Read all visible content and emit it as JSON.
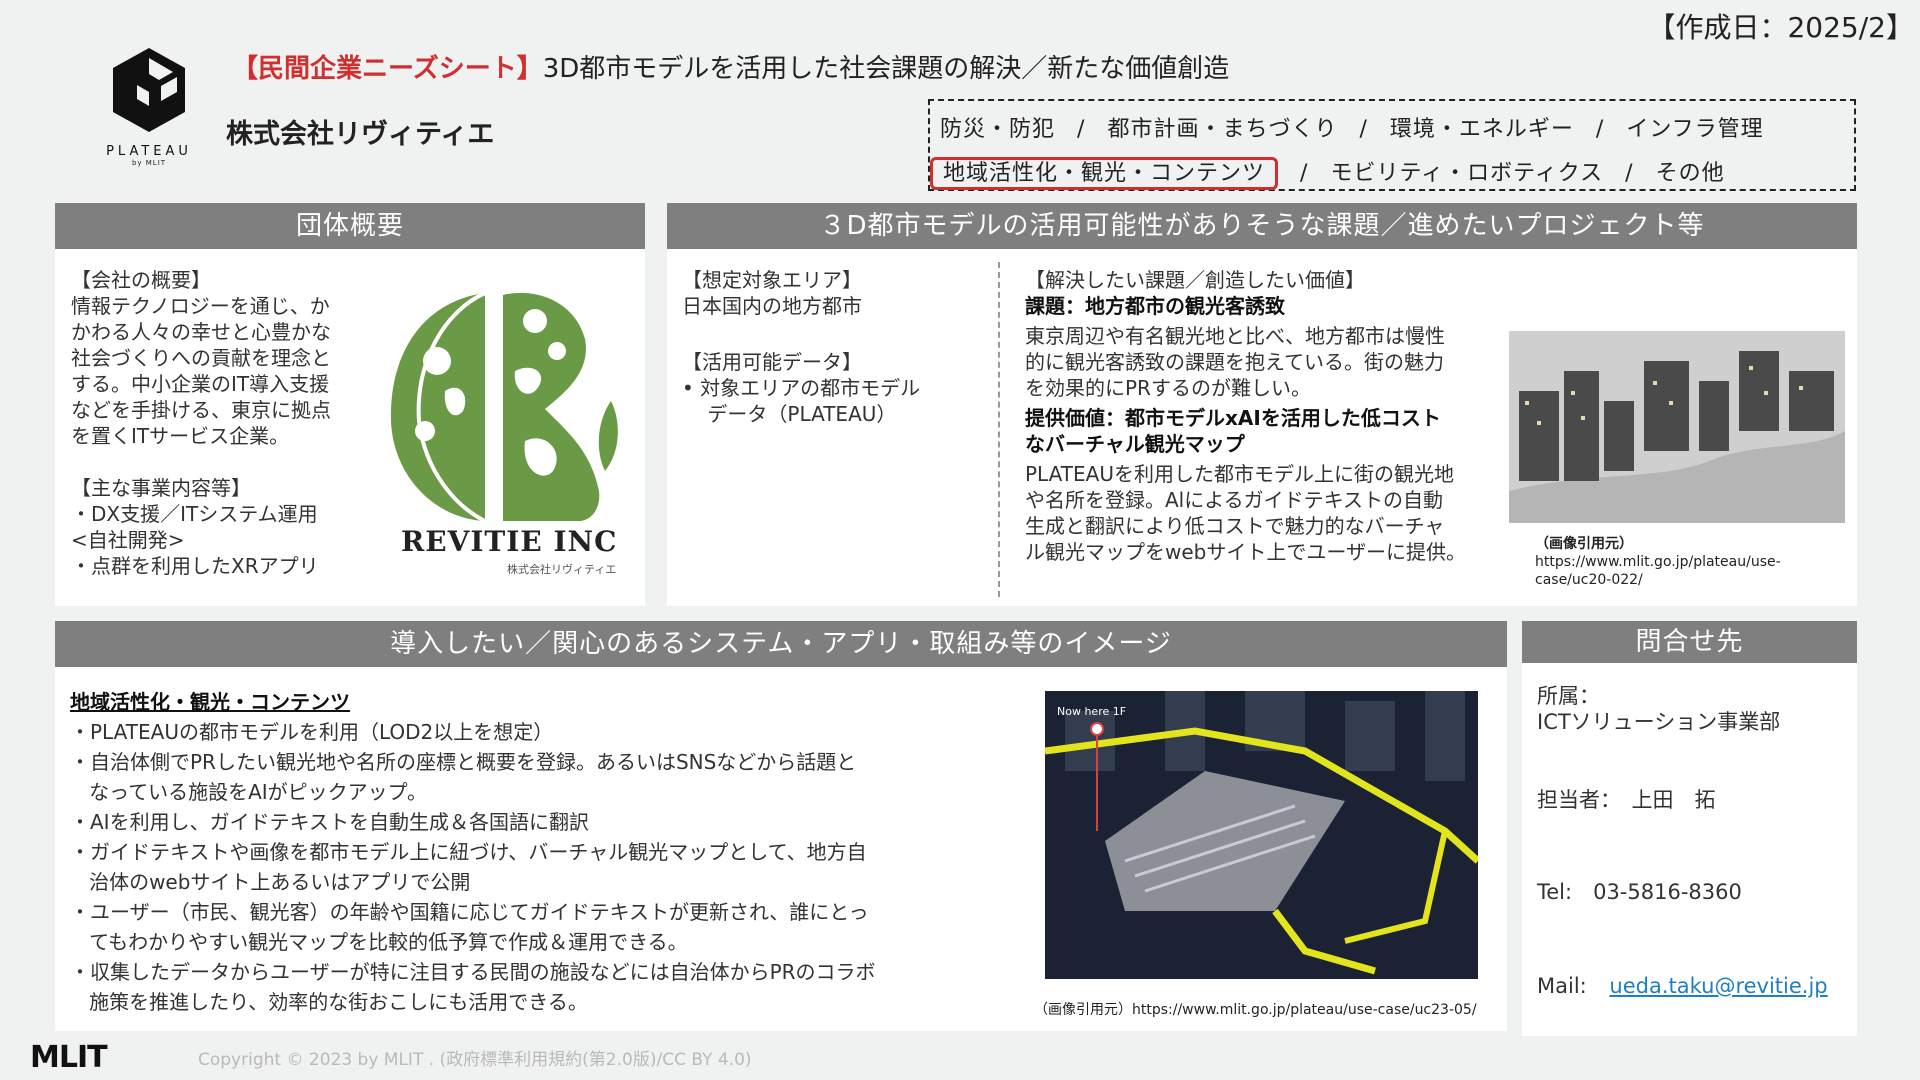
{
  "header": {
    "date": "【作成日：2025/2】",
    "logo_name": "PLATEAU",
    "logo_sub": "by MLIT",
    "title_accent": "【民間企業ニーズシート】",
    "title_rest": "3D都市モデルを活用した社会課題の解決／新たな価値創造",
    "company": "株式会社リヴィティエ"
  },
  "categories": {
    "row1": [
      "防災・防犯",
      "都市計画・まちづくり",
      "環境・エネルギー",
      "インフラ管理"
    ],
    "row2": [
      "地域活性化・観光・コンテンツ",
      "モビリティ・ロボティクス",
      "その他"
    ],
    "separator": "/",
    "highlighted": "地域活性化・観光・コンテンツ",
    "highlight_color": "#d12f2f"
  },
  "overview": {
    "heading": "団体概要",
    "summary_label": "【会社の概要】",
    "summary_lines": [
      "情報テクノロジーを通じ、か",
      "かわる人々の幸せと心豊かな",
      "社会づくりへの貢献を理念と",
      "する。中小企業のIT導入支援",
      "などを手掛ける、東京に拠点",
      "を置くITサービス企業。"
    ],
    "business_label": "【主な事業内容等】",
    "business_lines": [
      "・DX支援／ITシステム運用",
      "<自社開発>",
      "・点群を利用したXRアプリ"
    ],
    "brand_name": "REVITIE INC",
    "brand_sub": "株式会社リヴィティエ"
  },
  "issues": {
    "heading": "３D都市モデルの活用可能性がありそうな課題／進めたいプロジェクト等",
    "area_label": "【想定対象エリア】",
    "area_value": "日本国内の地方都市",
    "data_label": "【活用可能データ】",
    "data_lines": [
      "•  対象エリアの都市モデル",
      "    データ（PLATEAU）"
    ],
    "solve_label": "【解決したい課題／創造したい価値】",
    "issue_title": "課題：地方都市の観光客誘致",
    "issue_lines": [
      "東京周辺や有名観光地と比べ、地方都市は慢性",
      "的に観光客誘致の課題を抱えている。街の魅力",
      "を効果的にPRするのが難しい。"
    ],
    "value_title_lines": [
      "提供価値：都市モデルxAIを活用した低コスト",
      "なバーチャル観光マップ"
    ],
    "value_lines": [
      "PLATEAUを利用した都市モデル上に街の観光地",
      "や名所を登録。Alによるガイドテキストの自動",
      "生成と翻訳により低コストで魅力的なバーチャ",
      "ル観光マップをwebサイト上でユーザーに提供。"
    ],
    "caption_label": "（画像引用元）",
    "caption_url_lines": [
      "https://www.mlit.go.jp/plateau/use-",
      "case/uc20-022/"
    ]
  },
  "system": {
    "heading": "導入したい／関心のあるシステム・アプリ・取組み等のイメージ",
    "section_title": "地域活性化・観光・コンテンツ",
    "lines": [
      "・PLATEAUの都市モデルを利用（LOD2以上を想定）",
      "・自治体側でPRしたい観光地や名所の座標と概要を登録。あるいはSNSなどから話題と",
      "   なっている施設をAIがピックアップ。",
      "・AIを利用し、ガイドテキストを自動生成＆各国語に翻訳",
      "・ガイドテキストや画像を都市モデル上に紐づけ、バーチャル観光マップとして、地方自",
      "   治体のwebサイト上あるいはアプリで公開",
      "・ユーザー（市民、観光客）の年齢や国籍に応じてガイドテキストが更新され、誰にとっ",
      "   てもわかりやすい観光マップを比較的低予算で作成＆運用できる。",
      "・収集したデータからユーザーが特に注目する民間の施設などには自治体からPRのコラボ",
      "   施策を推進したり、効率的な街おこしにも活用できる。"
    ],
    "image_label": "Now here 1F",
    "caption": "（画像引用元）https://www.mlit.go.jp/plateau/use-case/uc23-05/"
  },
  "contact": {
    "heading": "問合せ先",
    "dept_label": "所属：",
    "dept_value": "ICTソリューション事業部",
    "person": "担当者：　上田　拓",
    "tel": "Tel:　03-5816-8360",
    "mail_label": "Mail:",
    "mail_value": "ueda.taku@revitie.jp"
  },
  "footer": {
    "logo": "MLIT",
    "copyright": "Copyright © 2023 by MLIT . (政府標準利用規約(第2.0版)/CC BY 4.0)"
  }
}
